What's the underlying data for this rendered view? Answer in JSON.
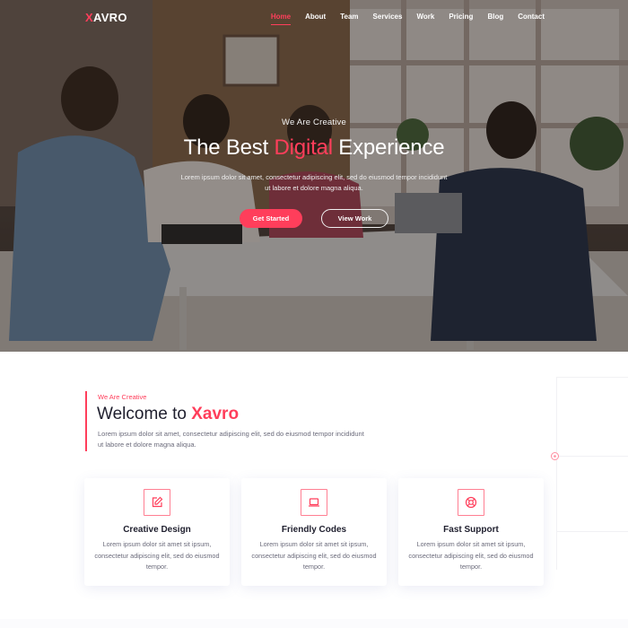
{
  "brand": {
    "logo_first": "X",
    "logo_rest": "AVRO"
  },
  "nav": {
    "items": [
      {
        "label": "Home",
        "active": true
      },
      {
        "label": "About"
      },
      {
        "label": "Team"
      },
      {
        "label": "Services"
      },
      {
        "label": "Work"
      },
      {
        "label": "Pricing"
      },
      {
        "label": "Blog"
      },
      {
        "label": "Contact"
      }
    ]
  },
  "hero": {
    "eyebrow": "We Are Creative",
    "title_before": "The Best ",
    "title_highlight": "Digital",
    "title_after": " Experience",
    "subtitle": "Lorem ipsum dolor sit amet, consectetur adipiscing elit, sed do eiusmod tempor incididunt ut labore et dolore magna aliqua.",
    "primary_button": "Get Started",
    "secondary_button": "View Work"
  },
  "about": {
    "kicker": "We Are Creative",
    "title_before": "Welcome to ",
    "title_highlight": "Xavro",
    "description": "Lorem ipsum dolor sit amet, consectetur adipiscing elit, sed do eiusmod tempor incididunt ut labore et dolore magna aliqua."
  },
  "services": [
    {
      "icon": "edit-icon",
      "title": "Creative Design",
      "text": "Lorem ipsum dolor sit amet sit ipsum, consectetur adipiscing elit, sed do eiusmod tempor."
    },
    {
      "icon": "laptop-icon",
      "title": "Friendly Codes",
      "text": "Lorem ipsum dolor sit amet sit ipsum, consectetur adipiscing elit, sed do eiusmod tempor."
    },
    {
      "icon": "lifebuoy-icon",
      "title": "Fast Support",
      "text": "Lorem ipsum dolor sit amet sit ipsum, consectetur adipiscing elit, sed do eiusmod tempor."
    }
  ],
  "colors": {
    "accent": "#ff3e5b",
    "heading": "#1f1f2e",
    "text": "#6b6b7b"
  }
}
